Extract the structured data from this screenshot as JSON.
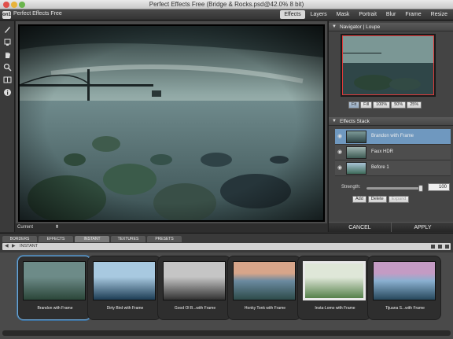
{
  "window": {
    "title": "Perfect Effects Free (Bridge & Rocks.psd@42.0% 8 bit)"
  },
  "toolbar": {
    "app_name": "Perfect Effects Free",
    "logo_text": "on1",
    "modules": [
      "Effects",
      "Layers",
      "Mask",
      "Portrait",
      "Blur",
      "Frame",
      "Resize"
    ],
    "active_module": "Effects"
  },
  "tools": [
    {
      "icon": "brush-icon"
    },
    {
      "icon": "masking-bug-icon"
    },
    {
      "icon": "hand-icon"
    },
    {
      "icon": "zoom-icon"
    },
    {
      "icon": "compare-icon"
    },
    {
      "icon": "info-icon"
    }
  ],
  "canvas": {
    "preview_label": "Current",
    "preview_arrow": "⬍"
  },
  "navigator": {
    "title": "Navigator | Loupe",
    "zoom_options": [
      "Fit",
      "Fill",
      "100%",
      "50%",
      "25%"
    ],
    "active_zoom": "Fit"
  },
  "effects_stack": {
    "title": "Effects Stack",
    "layers": [
      {
        "label": "Brandon with Frame",
        "selected": true
      },
      {
        "label": "Faux HDR",
        "selected": false
      },
      {
        "label": "Before 1",
        "selected": false
      }
    ],
    "strength_label": "Strength:",
    "strength_value": "100",
    "add_label": "Add",
    "delete_label": "Delete",
    "expand_label": "Expand"
  },
  "actions": {
    "cancel_label": "CANCEL",
    "apply_label": "APPLY"
  },
  "browser": {
    "tabs": [
      "BORDERS",
      "EFFECTS",
      "INSTANT",
      "TEXTURES",
      "PRESETS"
    ],
    "active_tab": "INSTANT",
    "path": "INSTANT",
    "presets": [
      {
        "label": "Brandon with Frame",
        "selected": true
      },
      {
        "label": "Dirty Bird with Frame",
        "selected": false
      },
      {
        "label": "Good Ol B...with Frame",
        "selected": false
      },
      {
        "label": "Honky Tonk with Frame",
        "selected": false
      },
      {
        "label": "Insta-Lomo with Frame",
        "selected": false
      },
      {
        "label": "Tijuana S...with Frame",
        "selected": false
      }
    ]
  }
}
